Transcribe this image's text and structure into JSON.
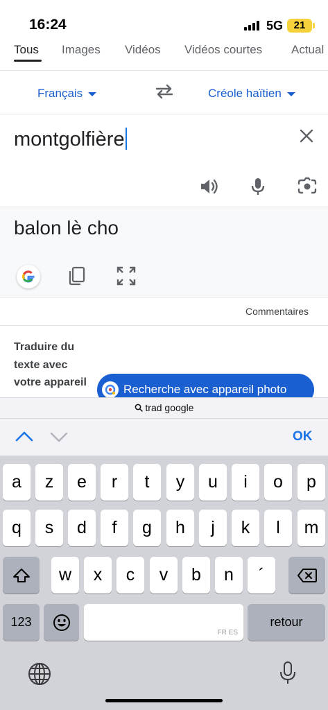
{
  "status_bar": {
    "time": "16:24",
    "network": "5G",
    "battery": "21"
  },
  "tabs": [
    {
      "label": "Tous",
      "active": true
    },
    {
      "label": "Images",
      "active": false
    },
    {
      "label": "Vidéos",
      "active": false
    },
    {
      "label": "Vidéos courtes",
      "active": false
    },
    {
      "label": "Actual",
      "active": false
    }
  ],
  "translator": {
    "source_language": "Français",
    "target_language": "Créole haïtien",
    "source_text": "montgolfière",
    "translated_text": "balon lè cho",
    "feedback_label": "Commentaires"
  },
  "promo": {
    "text": "Traduire du texte avec votre appareil",
    "camera_search_label": "Recherche avec appareil photo"
  },
  "browser": {
    "url_label": "trad google"
  },
  "accessory": {
    "done_label": "OK"
  },
  "keyboard": {
    "row1": [
      "a",
      "z",
      "e",
      "r",
      "t",
      "y",
      "u",
      "i",
      "o",
      "p"
    ],
    "row2": [
      "q",
      "s",
      "d",
      "f",
      "g",
      "h",
      "j",
      "k",
      "l",
      "m"
    ],
    "row3": [
      "w",
      "x",
      "c",
      "v",
      "b",
      "n",
      "´"
    ],
    "numbers_label": "123",
    "return_label": "retour",
    "space_languages": "FR ES"
  },
  "colors": {
    "accent": "#1a5fd1",
    "keyboard_bg": "#d1d3d9",
    "battery": "#f6d33c"
  }
}
